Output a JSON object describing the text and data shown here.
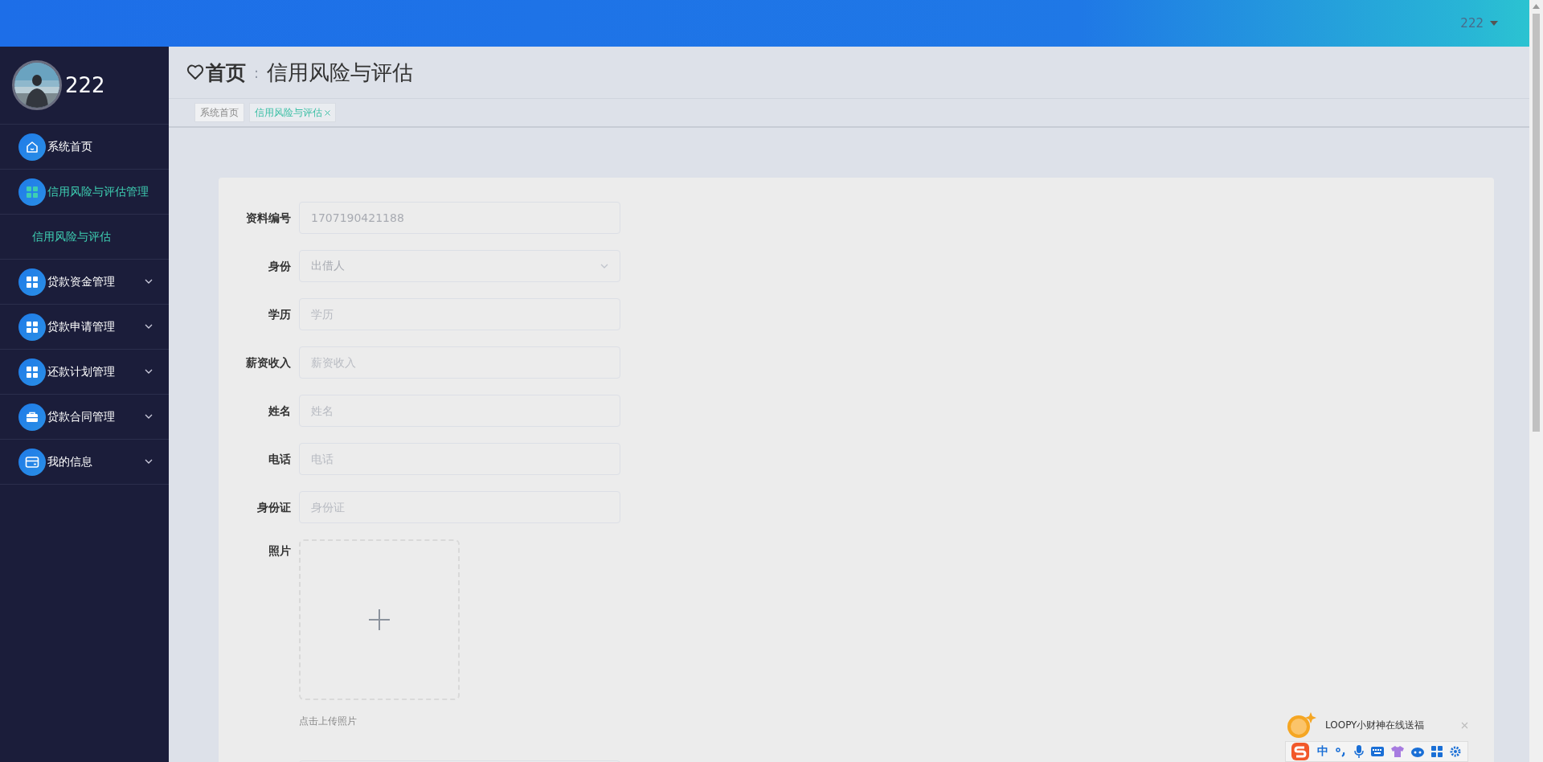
{
  "header": {
    "user": "222"
  },
  "sidebar": {
    "user_name": "222",
    "items": [
      {
        "label": "系统首页",
        "kind": "link",
        "selected": false
      },
      {
        "label": "信用风险与评估管理",
        "kind": "group",
        "selected": true,
        "expanded": true,
        "children": [
          {
            "label": "信用风险与评估",
            "selected": true
          }
        ]
      },
      {
        "label": "贷款资金管理",
        "kind": "group",
        "selected": false,
        "expanded": false
      },
      {
        "label": "贷款申请管理",
        "kind": "group",
        "selected": false,
        "expanded": false
      },
      {
        "label": "还款计划管理",
        "kind": "group",
        "selected": false,
        "expanded": false
      },
      {
        "label": "贷款合同管理",
        "kind": "group",
        "selected": false,
        "expanded": false
      },
      {
        "label": "我的信息",
        "kind": "group",
        "selected": false,
        "expanded": false
      }
    ]
  },
  "breadcrumb": {
    "home": "首页",
    "separator": ":",
    "current": "信用风险与评估"
  },
  "tabs": [
    {
      "label": "系统首页",
      "selected": false
    },
    {
      "label": "信用风险与评估",
      "selected": true
    }
  ],
  "form": {
    "fields": [
      {
        "kind": "input",
        "label": "资料编号",
        "value": "1707190421188"
      },
      {
        "kind": "select",
        "label": "身份",
        "value": "出借人"
      },
      {
        "kind": "input",
        "label": "学历",
        "placeholder": "学历"
      },
      {
        "kind": "input",
        "label": "薪资收入",
        "placeholder": "薪资收入"
      },
      {
        "kind": "input",
        "label": "姓名",
        "placeholder": "姓名"
      },
      {
        "kind": "input",
        "label": "电话",
        "placeholder": "电话"
      },
      {
        "kind": "input",
        "label": "身份证",
        "placeholder": "身份证"
      },
      {
        "kind": "upload",
        "label": "照片",
        "hint": "点击上传照片"
      },
      {
        "kind": "input"
      }
    ]
  },
  "ime_bar": {
    "tip": "LOOPY小财神在线送福",
    "mode": "中"
  }
}
